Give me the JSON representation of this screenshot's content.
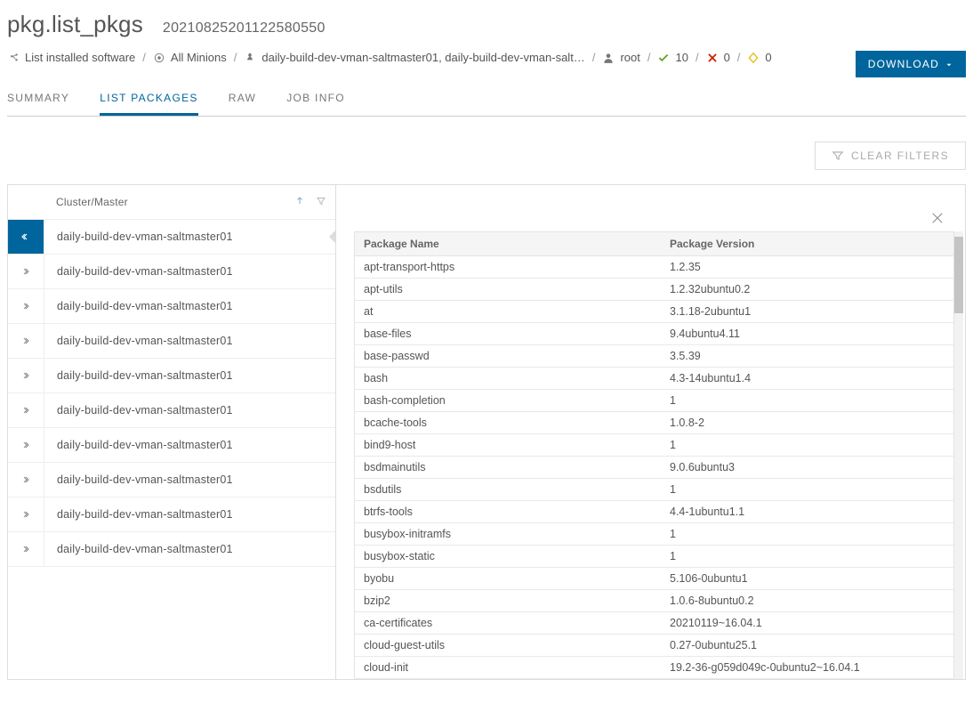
{
  "header": {
    "title": "pkg.list_pkgs",
    "run_id": "20210825201122580550"
  },
  "breadcrumb": {
    "step1": "List installed software",
    "step2": "All Minions",
    "step3": "daily-build-dev-vman-saltmaster01, daily-build-dev-vman-salt…",
    "user": "root",
    "success_count": "10",
    "fail_count": "0",
    "pending_count": "0"
  },
  "download_label": "DOWNLOAD",
  "tabs": {
    "summary": "SUMMARY",
    "list_packages": "LIST PACKAGES",
    "raw": "RAW",
    "job_info": "JOB INFO"
  },
  "clear_filters_label": "CLEAR FILTERS",
  "sidebar": {
    "header": "Cluster/Master",
    "items": [
      {
        "label": "daily-build-dev-vman-saltmaster01",
        "selected": true
      },
      {
        "label": "daily-build-dev-vman-saltmaster01"
      },
      {
        "label": "daily-build-dev-vman-saltmaster01"
      },
      {
        "label": "daily-build-dev-vman-saltmaster01"
      },
      {
        "label": "daily-build-dev-vman-saltmaster01"
      },
      {
        "label": "daily-build-dev-vman-saltmaster01"
      },
      {
        "label": "daily-build-dev-vman-saltmaster01"
      },
      {
        "label": "daily-build-dev-vman-saltmaster01"
      },
      {
        "label": "daily-build-dev-vman-saltmaster01"
      },
      {
        "label": "daily-build-dev-vman-saltmaster01"
      }
    ]
  },
  "pkg_table": {
    "col_name": "Package Name",
    "col_ver": "Package Version",
    "rows": [
      {
        "name": "apt-transport-https",
        "ver": "1.2.35"
      },
      {
        "name": "apt-utils",
        "ver": "1.2.32ubuntu0.2"
      },
      {
        "name": "at",
        "ver": "3.1.18-2ubuntu1"
      },
      {
        "name": "base-files",
        "ver": "9.4ubuntu4.11"
      },
      {
        "name": "base-passwd",
        "ver": "3.5.39"
      },
      {
        "name": "bash",
        "ver": "4.3-14ubuntu1.4"
      },
      {
        "name": "bash-completion",
        "ver": "1"
      },
      {
        "name": "bcache-tools",
        "ver": "1.0.8-2"
      },
      {
        "name": "bind9-host",
        "ver": "1"
      },
      {
        "name": "bsdmainutils",
        "ver": "9.0.6ubuntu3"
      },
      {
        "name": "bsdutils",
        "ver": "1"
      },
      {
        "name": "btrfs-tools",
        "ver": "4.4-1ubuntu1.1"
      },
      {
        "name": "busybox-initramfs",
        "ver": "1"
      },
      {
        "name": "busybox-static",
        "ver": "1"
      },
      {
        "name": "byobu",
        "ver": "5.106-0ubuntu1"
      },
      {
        "name": "bzip2",
        "ver": "1.0.6-8ubuntu0.2"
      },
      {
        "name": "ca-certificates",
        "ver": "20210119~16.04.1"
      },
      {
        "name": "cloud-guest-utils",
        "ver": "0.27-0ubuntu25.1"
      },
      {
        "name": "cloud-init",
        "ver": "19.2-36-g059d049c-0ubuntu2~16.04.1"
      }
    ]
  }
}
